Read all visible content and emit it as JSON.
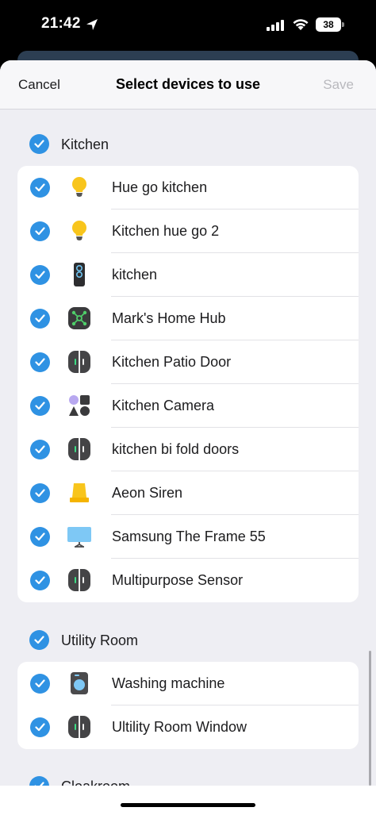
{
  "status_bar": {
    "time": "21:42",
    "battery": "38"
  },
  "nav": {
    "cancel": "Cancel",
    "title": "Select devices to use",
    "save": "Save"
  },
  "sections": [
    {
      "label": "Kitchen",
      "checked": true
    },
    {
      "label": "Utility Room",
      "checked": true
    },
    {
      "label": "Cloakroom",
      "checked": true
    }
  ],
  "kitchen_devices": [
    {
      "name": "Hue go kitchen",
      "icon": "bulb-icon"
    },
    {
      "name": "Kitchen hue go 2",
      "icon": "bulb-icon"
    },
    {
      "name": "kitchen",
      "icon": "remote-icon"
    },
    {
      "name": "Mark's Home Hub",
      "icon": "hub-icon"
    },
    {
      "name": "Kitchen Patio Door",
      "icon": "contact-sensor-icon"
    },
    {
      "name": "Kitchen Camera",
      "icon": "generic-device-icon"
    },
    {
      "name": "kitchen bi fold doors",
      "icon": "contact-sensor-icon"
    },
    {
      "name": "Aeon Siren",
      "icon": "siren-icon"
    },
    {
      "name": "Samsung The Frame 55",
      "icon": "tv-icon"
    },
    {
      "name": "Multipurpose Sensor",
      "icon": "contact-sensor-icon"
    }
  ],
  "utility_devices": [
    {
      "name": "Washing machine",
      "icon": "washer-icon"
    },
    {
      "name": "Ultility Room Window",
      "icon": "contact-sensor-icon"
    }
  ],
  "colors": {
    "accent": "#2f92e3",
    "bulb": "#f8c51c",
    "tv": "#7ec8f5",
    "hub_green": "#4fcf6a",
    "sensor_green": "#3ddc84"
  }
}
